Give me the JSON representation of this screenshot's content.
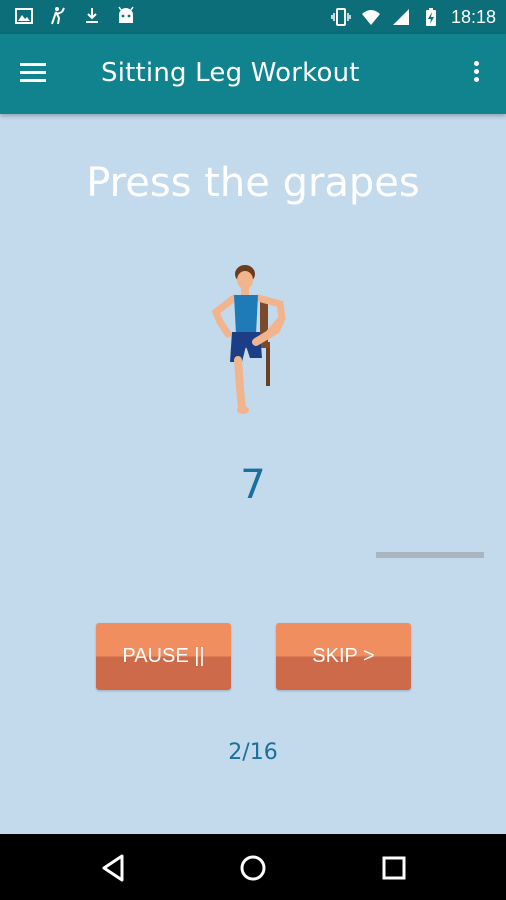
{
  "status_bar": {
    "time": "18:18",
    "left_icons": [
      "image-icon",
      "golf-icon",
      "download-icon",
      "android-icon"
    ],
    "right_icons": [
      "vibrate-icon",
      "wifi-icon",
      "signal-icon",
      "battery-charging-icon"
    ]
  },
  "app_bar": {
    "title": "Sitting Leg Workout",
    "menu_icon": "hamburger-menu-icon",
    "overflow_icon": "more-vert-icon"
  },
  "exercise": {
    "title": "Press the grapes",
    "count": "7",
    "progress": 0
  },
  "controls": {
    "pause_label": "PAUSE ||",
    "skip_label": "SKIP >"
  },
  "step": {
    "label": "2/16"
  },
  "colors": {
    "status_bar": "#0b6e78",
    "app_bar": "#10838f",
    "background": "#c3d9ec",
    "button_top": "#f08e60",
    "button_bottom": "#cd6a4a",
    "accent_text": "#1a6f9c"
  },
  "nav_bar": {
    "icons": [
      "back-icon",
      "home-icon",
      "recent-apps-icon"
    ]
  }
}
